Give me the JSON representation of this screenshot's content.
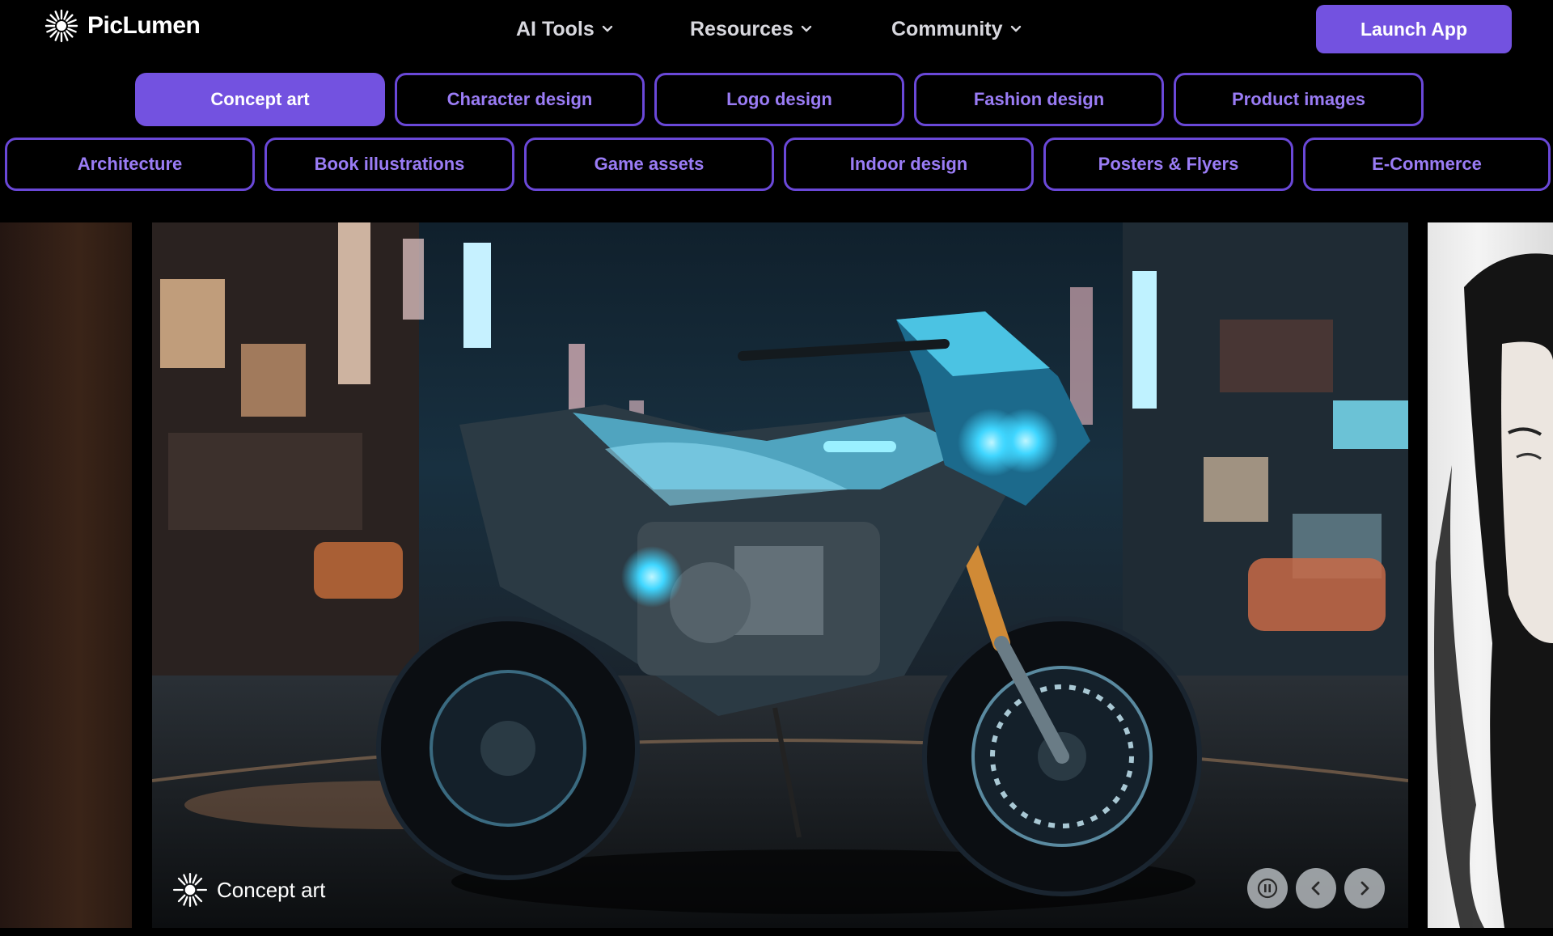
{
  "brand": {
    "name": "PicLumen"
  },
  "nav": {
    "items": [
      {
        "label": "AI Tools"
      },
      {
        "label": "Resources"
      },
      {
        "label": "Community"
      }
    ],
    "launch_label": "Launch App"
  },
  "categories": {
    "row1": [
      "Concept art",
      "Character design",
      "Logo design",
      "Fashion design",
      "Product images"
    ],
    "row2": [
      "Architecture",
      "Book illustrations",
      "Game assets",
      "Indoor design",
      "Posters & Flyers",
      "E-Commerce"
    ],
    "active": "Concept art"
  },
  "slide": {
    "caption": "Concept art"
  },
  "colors": {
    "accent": "#7352e0",
    "chip_text": "#9a7cf5",
    "background": "#000000"
  },
  "icons": {
    "logo": "sparkle-icon",
    "dropdown": "chevron-down-icon",
    "pause": "pause-icon",
    "prev": "chevron-left-icon",
    "next": "chevron-right-icon"
  }
}
